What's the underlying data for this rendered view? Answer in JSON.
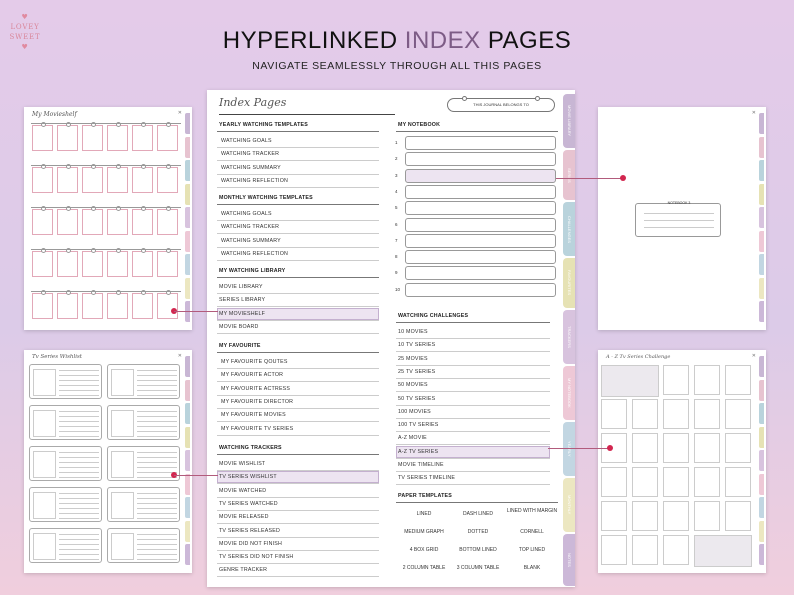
{
  "brand": {
    "line1": "LOVEY",
    "line2": "SWEET",
    "heart": "♥"
  },
  "headline": {
    "part1": "HYPERLINKED ",
    "accent": "INDEX",
    "part2": "  PAGES"
  },
  "subheadline": "NAVIGATE SEAMLESSLY THROUGH ALL THIS PAGES",
  "colors": {
    "accent": "#7d5c86",
    "connector": "#d2264f",
    "highlight": "#ede4f1"
  },
  "index_page": {
    "title": "Index Pages",
    "belongs_to": "THIS JOURNAL BELONGS TO",
    "tabs": [
      {
        "label": "MOVIE LIBRARY",
        "color": "#c8b6d4"
      },
      {
        "label": "SERIES",
        "color": "#e7c3d0"
      },
      {
        "label": "CHALLENGES",
        "color": "#b9d3dc"
      },
      {
        "label": "FAVOURITES",
        "color": "#e6e2b4"
      },
      {
        "label": "TRACKERS",
        "color": "#d8c3de"
      },
      {
        "label": "MY NOTEBOOK",
        "color": "#eec8d6"
      },
      {
        "label": "YEARLY",
        "color": "#c2d6e2"
      },
      {
        "label": "MONTHLY",
        "color": "#ece7c1"
      },
      {
        "label": "NOTES",
        "color": "#ccb8d8"
      }
    ],
    "yearly": {
      "heading": "YEARLY WATCHING TEMPLATES",
      "items": [
        "WATCHING GOALS",
        "WATCHING TRACKER",
        "WATCHING SUMMARY",
        "WATCHING REFLECTION"
      ]
    },
    "monthly": {
      "heading": "MONTHLY WATCHING TEMPLATES",
      "items": [
        "WATCHING GOALS",
        "WATCHING TRACKER",
        "WATCHING SUMMARY",
        "WATCHING REFLECTION"
      ]
    },
    "library": {
      "heading": "MY WATCHING LIBRARY",
      "items": [
        "MOVIE LIBRARY",
        "SERIES LIBRARY",
        "MY MOVIESHELF",
        "MOVIE BOARD"
      ]
    },
    "favourite": {
      "heading": "MY FAVOURITE",
      "items": [
        "MY FAVOURITE QOUTES",
        "MY FAVOURITE ACTOR",
        "MY FAVOURITE ACTRESS",
        "MY FAVOURITE DIRECTOR",
        "MY FAVOURITE MOVIES",
        "MY FAVOURITE TV SERIES"
      ]
    },
    "trackers": {
      "heading": "WATCHING TRACKERS",
      "items": [
        "MOVIE WISHLIST",
        "TV SERIES WISHLIST",
        "MOVIE WATCHED",
        "TV SERIES WATCHED",
        "MOVIE RELEASED",
        "TV SERIES RELEASED",
        "MOVIE DID NOT FINISH",
        "TV SERIES DID NOT FINISH",
        "GENRE TRACKER"
      ]
    },
    "notebook": {
      "heading": "MY NOTEBOOK",
      "numbers": [
        "1",
        "2",
        "3",
        "4",
        "5",
        "6",
        "7",
        "8",
        "9",
        "10"
      ]
    },
    "challenges": {
      "heading": "WATCHING CHALLENGES",
      "items": [
        "10 MOVIES",
        "10 TV SERIES",
        "25 MOVIES",
        "25 TV SERIES",
        "50 MOVIES",
        "50 TV SERIES",
        "100 MOVIES",
        "100 TV SERIES",
        "A-Z MOVIE",
        "A-Z TV SERIES",
        "MOVIE TIMELINE",
        "TV SERIES TIMELINE"
      ]
    },
    "paper": {
      "heading": "PAPER TEMPLATES",
      "cells": [
        "LINED",
        "DASH LINED",
        "LINED WITH MARGIN",
        "MEDIUM GRAPH",
        "DOTTED",
        "CORNELL",
        "4 BOX GRID",
        "BOTTOM LINED",
        "TOP LINED",
        "2 COLUMN TABLE",
        "3 COLUMN TABLE",
        "BLANK"
      ]
    }
  },
  "movieshelf_page": {
    "title": "My Movieshelf"
  },
  "notebook_page": {
    "card_label": "NOTEBOOK 3"
  },
  "wishlist_page": {
    "title": "Tv Series Wishlist",
    "field_labels": [
      "TITLE",
      "GENRE",
      "RELEASE DATE",
      "PLATFORM",
      "SEASONS",
      "WATCHED"
    ]
  },
  "az_page": {
    "title": "A - Z Tv Series Challenge",
    "close": "✕"
  }
}
